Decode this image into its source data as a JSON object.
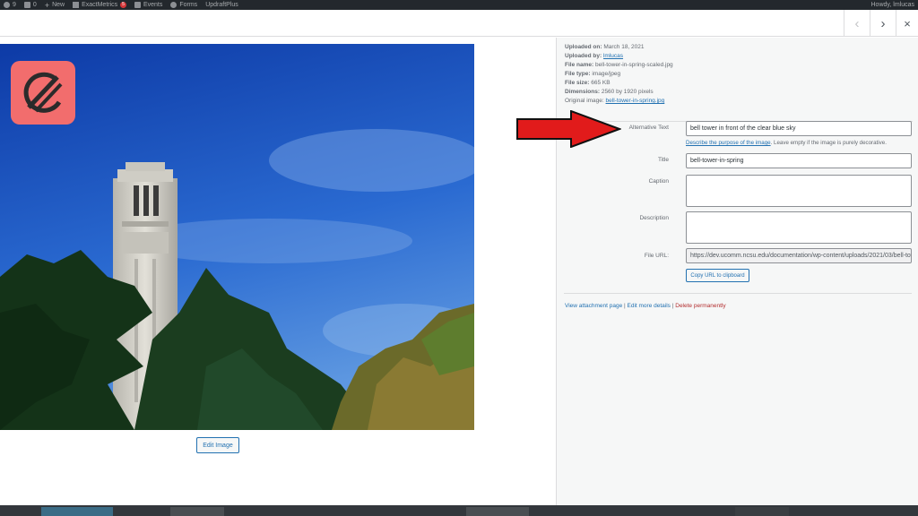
{
  "admin_bar": {
    "updates_count": "9",
    "comments_count": "0",
    "new_label": "New",
    "exactmetrics_label": "ExactMetrics",
    "exactmetrics_badge": "5",
    "events_label": "Events",
    "forms_label": "Forms",
    "updraft_label": "UpdraftPlus",
    "howdy": "Howdy, lmlucas"
  },
  "modal_nav": {
    "prev_icon": "‹",
    "next_icon": "›",
    "close_icon": "×"
  },
  "attachment": {
    "uploaded_on_label": "Uploaded on:",
    "uploaded_on": "March 18, 2021",
    "uploaded_by_label": "Uploaded by:",
    "uploaded_by": "lmlucas",
    "file_name_label": "File name:",
    "file_name": "bell-tower-in-spring-scaled.jpg",
    "file_type_label": "File type:",
    "file_type": "image/jpeg",
    "file_size_label": "File size:",
    "file_size": "665 KB",
    "dimensions_label": "Dimensions:",
    "dimensions": "2560 by 1920 pixels",
    "original_image_label": "Original image:",
    "original_image": "bell-tower-in-spring.jpg"
  },
  "fields": {
    "alt_label": "Alternative Text",
    "alt_value": "bell tower in front of the clear blue sky",
    "alt_help_link": "Describe the purpose of the image",
    "alt_help_rest": ". Leave empty if the image is purely decorative.",
    "title_label": "Title",
    "title_value": "bell-tower-in-spring",
    "caption_label": "Caption",
    "description_label": "Description",
    "file_url_label": "File URL:",
    "file_url_value": "https://dev.ucomm.ncsu.edu/documentation/wp-content/uploads/2021/03/bell-tower-in-spring-scaled.jpg",
    "copy_button": "Copy URL to clipboard"
  },
  "actions": {
    "view_attachment": "View attachment page",
    "edit_more": "Edit more details",
    "delete": "Delete permanently",
    "separator": " | "
  },
  "edit_image_button": "Edit Image",
  "colors": {
    "accent": "#2271b1",
    "danger": "#b32d2e",
    "arrow": "#e11b1b",
    "logo": "#f26d6d"
  }
}
